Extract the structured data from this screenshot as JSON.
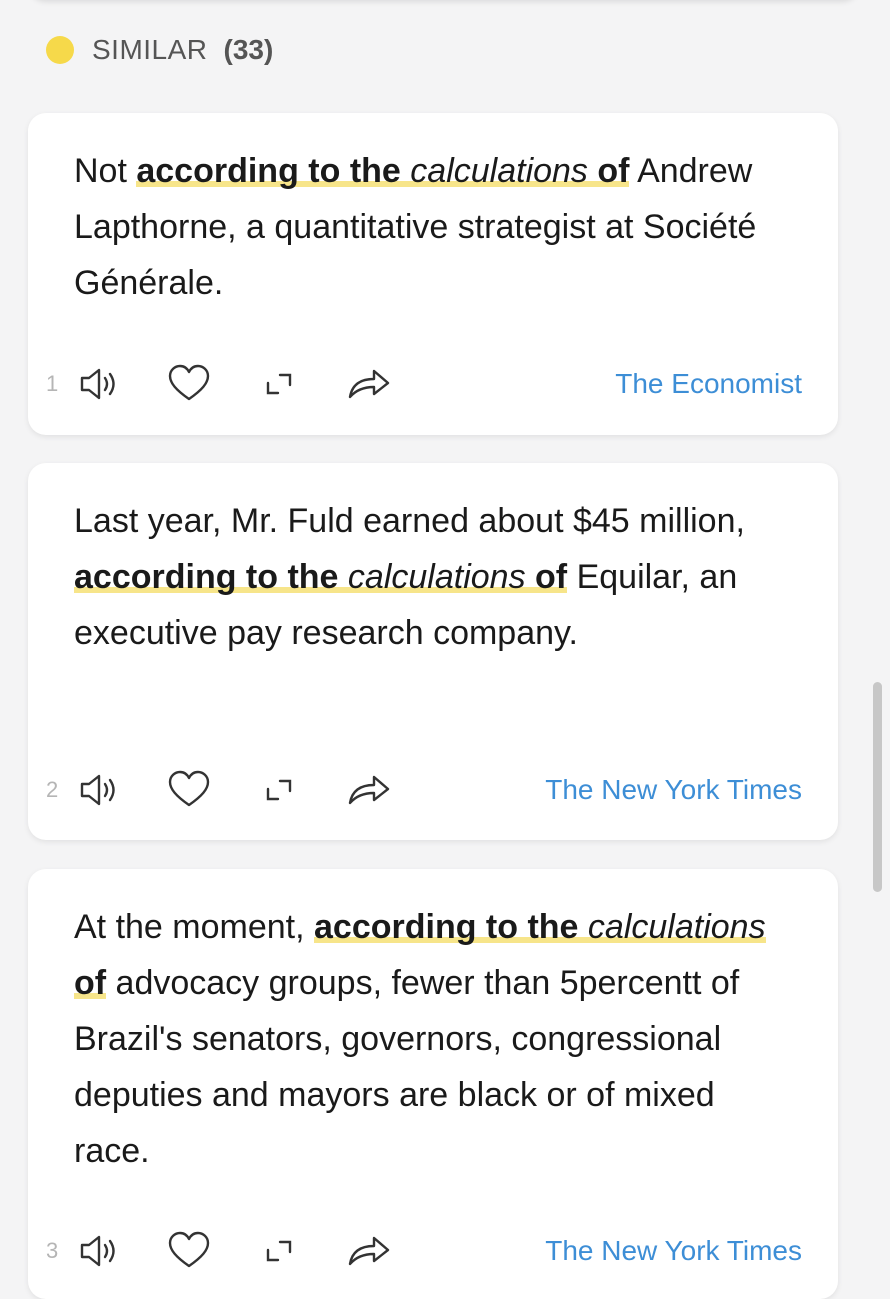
{
  "section": {
    "title": "SIMILAR",
    "count": "(33)",
    "accent": "#f6d94a"
  },
  "colors": {
    "highlight": "#f7e58a",
    "source_link": "#3d8ed6"
  },
  "cards": [
    {
      "number": "1",
      "text_before": "Not ",
      "phrase_bold": "according to the",
      "phrase_italic": "calculations",
      "phrase_of": "of",
      "text_after": "Andrew Lapthorne, a quantitative strategist at Société Générale.",
      "source": "The Economist"
    },
    {
      "number": "2",
      "text_before": "Last year, Mr. Fuld earned about $45 million, ",
      "phrase_bold": "according to the",
      "phrase_italic": "calculations",
      "phrase_of": "of",
      "text_after": "Equilar, an executive pay research company.",
      "source": "The New York Times"
    },
    {
      "number": "3",
      "text_before": "At the moment, ",
      "phrase_bold": "according to the",
      "phrase_italic": "calculations",
      "phrase_of": "of",
      "text_after": "advocacy groups, fewer than 5percentt of Brazil's senators, governors, congressional deputies and mayors are black or of mixed race.",
      "source": "The New York Times"
    }
  ],
  "icons": [
    "speaker-icon",
    "heart-icon",
    "expand-icon",
    "share-icon"
  ]
}
